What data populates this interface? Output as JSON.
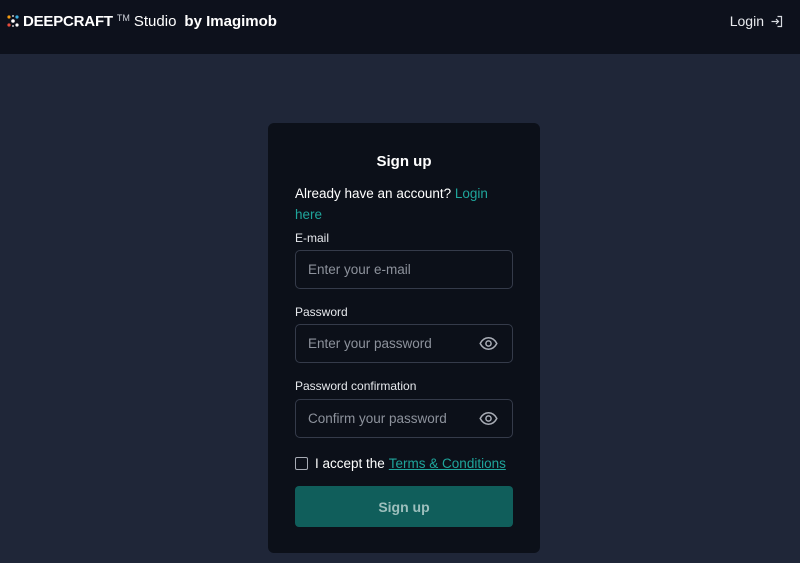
{
  "header": {
    "brand_name": "DEEPCRAFT",
    "brand_tm": "TM",
    "brand_studio": "Studio",
    "brand_by": "by Imagimob",
    "login_label": "Login",
    "login_icon": "login-arrow-icon"
  },
  "form": {
    "title": "Sign up",
    "already_text": "Already have an account?",
    "login_here": "Login here",
    "email": {
      "label": "E-mail",
      "placeholder": "Enter your e-mail"
    },
    "password": {
      "label": "Password",
      "placeholder": "Enter your password",
      "icon": "eye-icon"
    },
    "confirm": {
      "label": "Password confirmation",
      "placeholder": "Confirm your password",
      "icon": "eye-icon"
    },
    "terms": {
      "checked": false,
      "prefix": "I accept the",
      "link": "Terms & Conditions"
    },
    "submit_label": "Sign up"
  },
  "colors": {
    "page_bg": "#1f2638",
    "header_bg": "#0d111c",
    "card_bg": "#0c1019",
    "accent": "#1fa59b",
    "button_bg": "#105e5b"
  }
}
